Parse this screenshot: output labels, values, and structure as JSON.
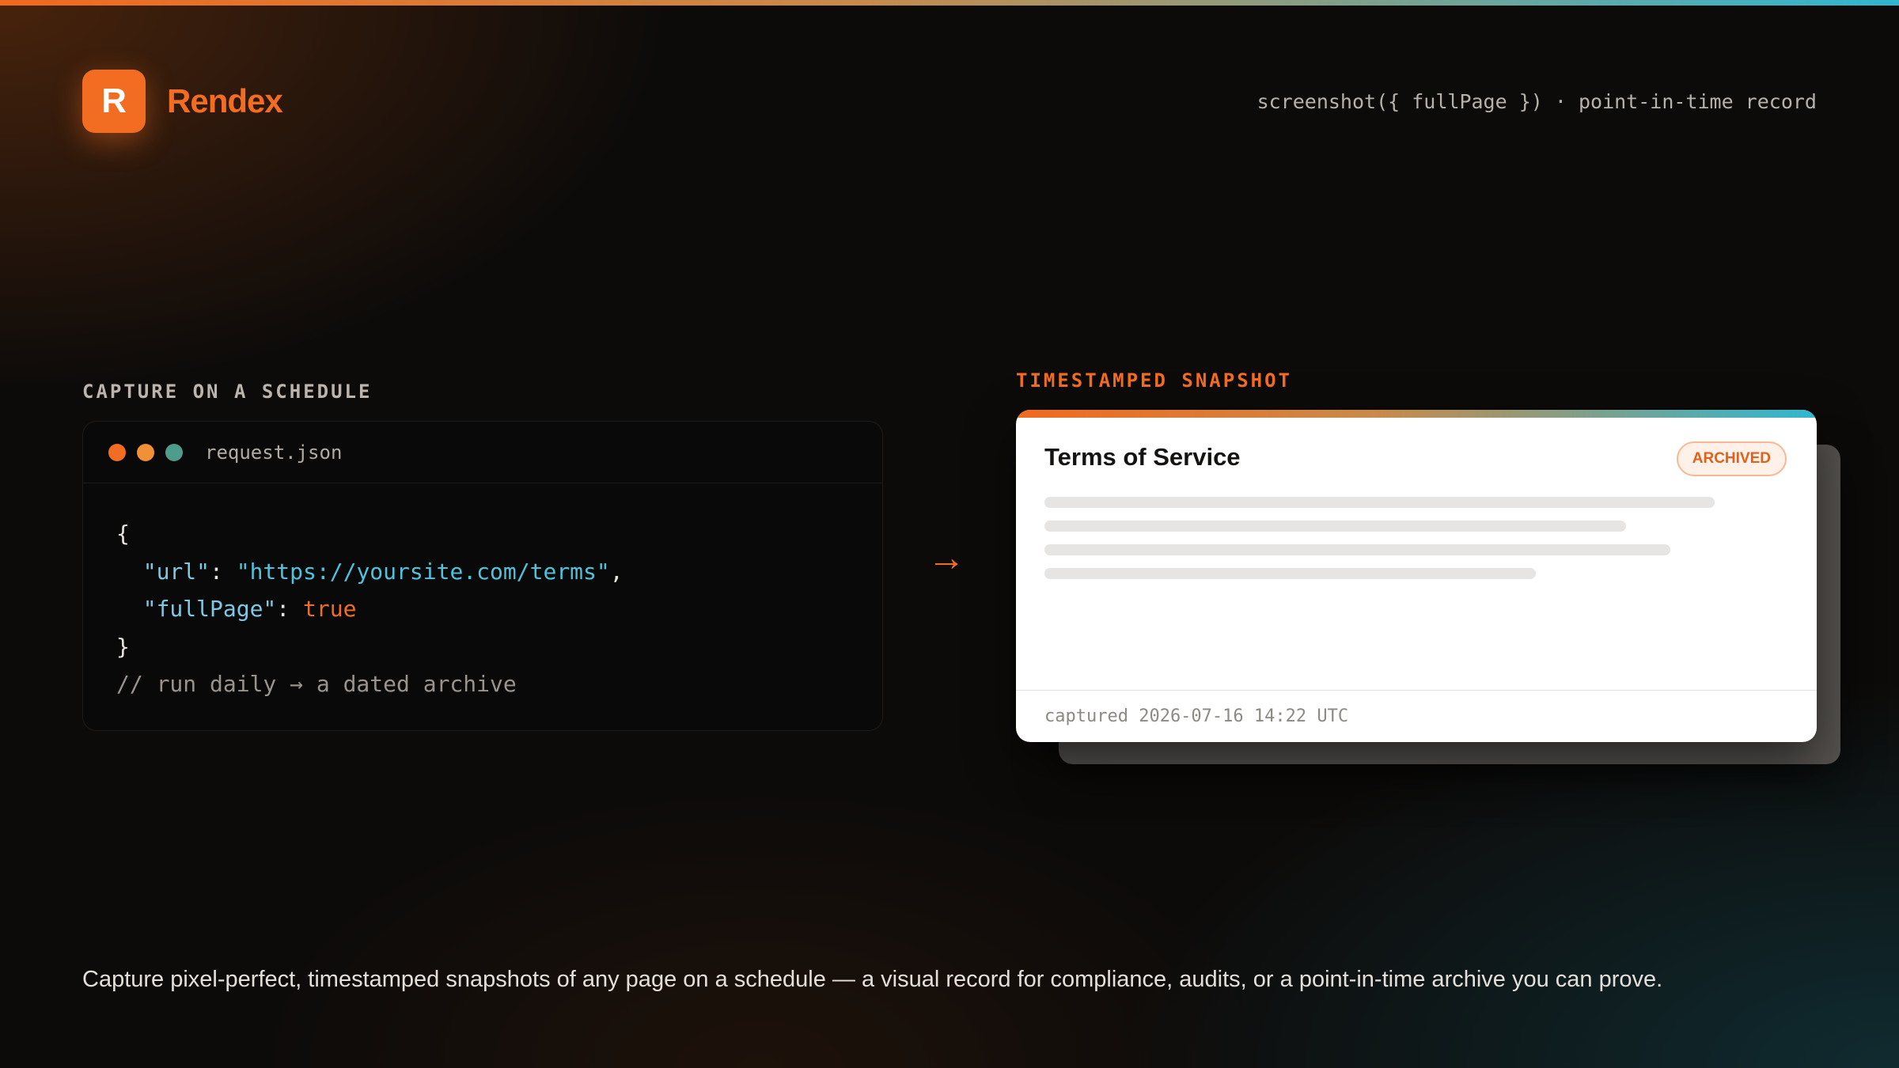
{
  "brand": {
    "logo_letter": "R",
    "name": "Rendex",
    "accent_color": "#f26d22"
  },
  "header": {
    "tagline": "screenshot({ fullPage }) · point-in-time record"
  },
  "left_panel": {
    "label": "CAPTURE ON A SCHEDULE",
    "file_name": "request.json",
    "window_dots": [
      "#f26d22",
      "#f29035",
      "#4e9c8c"
    ],
    "code": {
      "open_brace": "{",
      "url_key": "\"url\"",
      "url_value": "\"https://yoursite.com/terms\"",
      "fullpage_key": "\"fullPage\"",
      "fullpage_value": "true",
      "close_brace": "}",
      "comment": "// run daily → a dated archive"
    }
  },
  "connector": {
    "icon": "arrow-right-icon",
    "glyph": "→"
  },
  "right_panel": {
    "label": "TIMESTAMPED SNAPSHOT",
    "card_title": "Terms of Service",
    "badge": "ARCHIVED",
    "captured": "captured 2026-07-16 14:22 UTC"
  },
  "footer": {
    "description": "Capture pixel-perfect, timestamped snapshots of any page on a schedule — a visual record for compliance, audits, or a point-in-time archive you can prove."
  }
}
